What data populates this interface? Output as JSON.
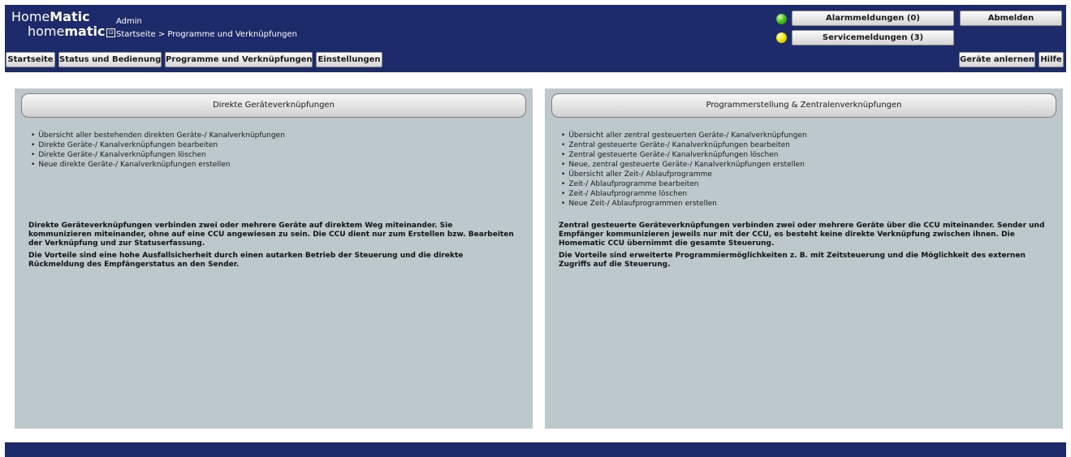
{
  "header": {
    "logo_line1_a": "Home",
    "logo_line1_b": "Matic",
    "logo_line2_a": "home",
    "logo_line2_b": "matic",
    "user": "Admin",
    "breadcrumb": "Startseite > Programme und Verknüpfungen",
    "alarm_label": "Alarmmeldungen (0)",
    "service_label": "Servicemeldungen (3)",
    "logout_label": "Abmelden",
    "status_colors": {
      "alarm": "#4cc51f",
      "service": "#f4e80a"
    }
  },
  "nav": {
    "items": [
      "Startseite",
      "Status und Bedienung",
      "Programme und Verknüpfungen",
      "Einstellungen"
    ],
    "right": [
      "Geräte anlernen",
      "Hilfe"
    ]
  },
  "left_panel": {
    "button": "Direkte Geräteverknüpfungen",
    "bullets": [
      "Übersicht aller bestehenden direkten Geräte-/ Kanalverknüpfungen",
      "Direkte Geräte-/ Kanalverknüpfungen bearbeiten",
      "Direkte Geräte-/ Kanalverknüpfungen löschen",
      "Neue direkte Geräte-/ Kanalverknüpfungen erstellen"
    ],
    "paragraphs": [
      "Direkte Geräteverknüpfungen verbinden zwei oder mehrere Geräte auf direktem Weg miteinander. Sie kommunizieren miteinander, ohne auf eine CCU angewiesen zu sein. Die CCU dient nur zum Erstellen bzw. Bearbeiten der Verknüpfung und zur Statuserfassung.",
      "Die Vorteile sind eine hohe Ausfallsicherheit durch einen autarken Betrieb der Steuerung und die direkte Rückmeldung des Empfängerstatus an den Sender."
    ]
  },
  "right_panel": {
    "button": "Programmerstellung & Zentralenverknüpfungen",
    "bullets": [
      "Übersicht aller zentral gesteuerten Geräte-/ Kanalverknüpfungen",
      "Zentral gesteuerte Geräte-/ Kanalverknüpfungen bearbeiten",
      "Zentral gesteuerte Geräte-/ Kanalverknüpfungen löschen",
      "Neue, zentral gesteuerte Geräte-/ Kanalverknüpfungen erstellen",
      "Übersicht aller Zeit-/ Ablaufprogramme",
      "Zeit-/ Ablaufprogramme bearbeiten",
      "Zeit-/ Ablaufprogramme löschen",
      "Neue Zeit-/ Ablaufprogrammen erstellen"
    ],
    "paragraphs": [
      "Zentral gesteuerte Geräteverknüpfungen verbinden zwei oder mehrere Geräte über die CCU miteinander. Sender und Empfänger kommunizieren jeweils nur mit der CCU, es besteht keine direkte Verknüpfung zwischen ihnen. Die Homematic CCU übernimmt die gesamte Steuerung.",
      "Die Vorteile sind erweiterte Programmiermöglichkeiten z. B. mit Zeitsteuerung und die Möglichkeit des externen Zugriffs auf die Steuerung."
    ]
  }
}
